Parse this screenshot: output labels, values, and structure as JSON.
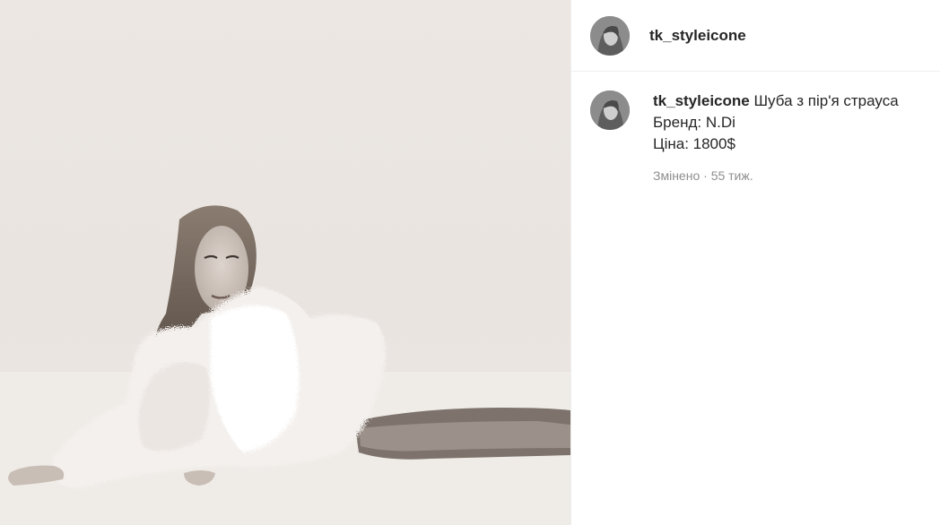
{
  "post": {
    "username": "tk_styleicone",
    "caption": {
      "username": "tk_styleicone",
      "line1": "Шуба з пір'я страуса",
      "line2": "Бренд: N.Di",
      "line3": "Ціна: 1800$"
    },
    "meta": {
      "edited_label": "Змінено",
      "separator": "·",
      "age": "55 тиж."
    }
  },
  "icons": {
    "header_avatar": "profile-avatar",
    "caption_avatar": "profile-avatar"
  },
  "colors": {
    "text_primary": "#262626",
    "text_secondary": "#8e8e8e",
    "divider": "#efefef",
    "photo_background": "#ece7e3"
  }
}
